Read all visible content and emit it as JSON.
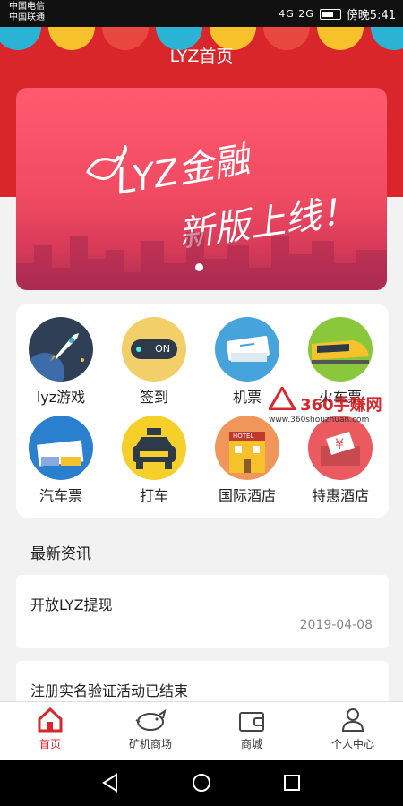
{
  "status_bar": {
    "carrier1": "中国电信",
    "carrier2": "中国联通",
    "network": "4G 2G",
    "time": "傍晚5:41"
  },
  "header": {
    "title": "LYZ首页"
  },
  "banner": {
    "line1": "LYZ金融",
    "line2": "新版上线！"
  },
  "menu": [
    {
      "label": "lyz游戏",
      "icon": "rocket-icon"
    },
    {
      "label": "签到",
      "icon": "toggle-on-icon",
      "badge": "ON"
    },
    {
      "label": "机票",
      "icon": "plane-ticket-icon"
    },
    {
      "label": "火车票",
      "icon": "train-icon"
    },
    {
      "label": "汽车票",
      "icon": "bus-ticket-icon"
    },
    {
      "label": "打车",
      "icon": "taxi-icon"
    },
    {
      "label": "国际酒店",
      "icon": "hotel-icon",
      "badge": "HOTEL"
    },
    {
      "label": "特惠酒店",
      "icon": "yen-coupon-icon",
      "badge": "¥"
    }
  ],
  "watermark": {
    "brand": "360手赚网",
    "url": "www.360shouzhuan.com"
  },
  "news": {
    "heading": "最新资讯",
    "items": [
      {
        "title": "开放LYZ提现",
        "date": "2019-04-08"
      },
      {
        "title": "注册实名验证活动已结束",
        "date": ""
      }
    ]
  },
  "nav": [
    {
      "label": "首页",
      "icon": "home-icon",
      "active": true
    },
    {
      "label": "矿机商场",
      "icon": "piggy-bank-icon"
    },
    {
      "label": "商城",
      "icon": "wallet-icon"
    },
    {
      "label": "个人中心",
      "icon": "user-icon"
    }
  ],
  "colors": {
    "primary": "#d8262b",
    "active_tab": "#d8262b"
  }
}
